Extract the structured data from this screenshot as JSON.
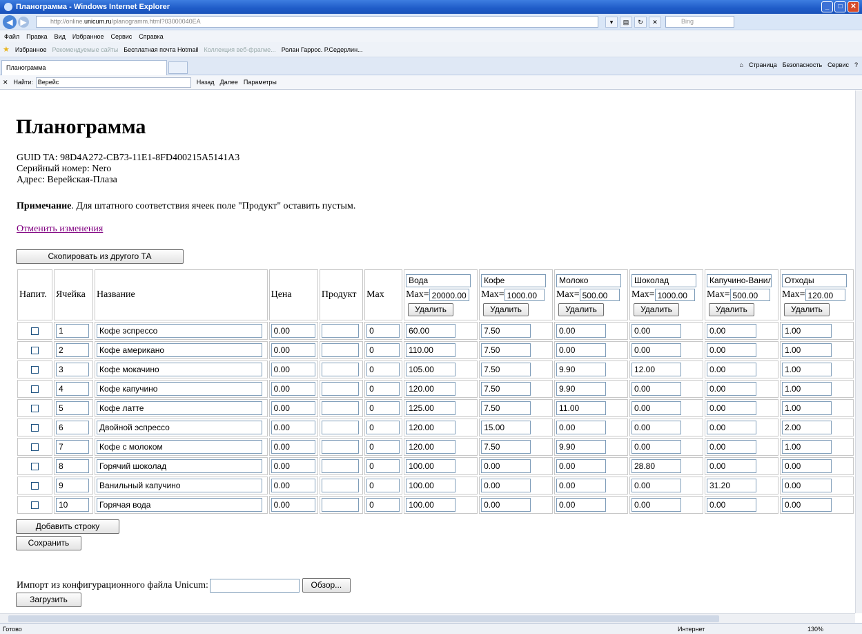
{
  "window": {
    "title": "Планограмма - Windows Internet Explorer"
  },
  "browser": {
    "url_prefix": "http://online.",
    "url_domain": "unicum.ru",
    "url_rest": "/planogramm.html?03000040EA",
    "search_placeholder": "Bing",
    "menu": [
      "Файл",
      "Правка",
      "Вид",
      "Избранное",
      "Сервис",
      "Справка"
    ],
    "favorites": [
      "Избранное",
      "Рекомендуемые сайты",
      "Бесплатная почта Hotmail",
      "Коллекция веб-фрагме...",
      "Ролан Гаррос. Р.Седерлин..."
    ],
    "tab_title": "Планограмма",
    "commands": [
      "Страница",
      "Безопасность",
      "Сервис"
    ],
    "find_label": "Найти:",
    "find_value": "Верейс",
    "find_prev": "Назад",
    "find_next": "Далее",
    "find_options": "Параметры",
    "status_left": "Готово",
    "status_zone": "Интернет",
    "status_zoom": "130%"
  },
  "page": {
    "title": "Планограмма",
    "guid_line": "GUID TA: 98D4A272-CB73-11E1-8FD400215A5141A3",
    "serial_line": "Серийный номер: Nero",
    "address_line": "Адрес: Верейская-Плаза",
    "note_bold": "Примечание",
    "note_text": ". Для штатного соответствия ячеек поле \"Продукт\" оставить пустым.",
    "cancel_link": "Отменить изменения",
    "copy_button": "Скопировать из другого ТА",
    "add_row_button": "Добавить строку",
    "save_button": "Сохранить",
    "import_label": "Импорт из конфигурационного файла Unicum:",
    "browse_button": "Обзор...",
    "load_button": "Загрузить"
  },
  "table": {
    "headers": {
      "drink": "Напит.",
      "cell": "Ячейка",
      "name": "Название",
      "price": "Цена",
      "product": "Продукт",
      "max": "Max"
    },
    "max_label": "Max=",
    "delete_label": "Удалить",
    "products": [
      {
        "name": "Вода",
        "max": "20000.00"
      },
      {
        "name": "Кофе",
        "max": "1000.00"
      },
      {
        "name": "Молоко",
        "max": "500.00"
      },
      {
        "name": "Шоколад",
        "max": "1000.00"
      },
      {
        "name": "Капучино-Ванильный",
        "max": "500.00"
      },
      {
        "name": "Отходы",
        "max": "120.00"
      }
    ],
    "rows": [
      {
        "cell": "1",
        "name": "Кофе эспрессо",
        "price": "0.00",
        "product": "",
        "max": "0",
        "p": [
          "60.00",
          "7.50",
          "0.00",
          "0.00",
          "0.00",
          "1.00"
        ]
      },
      {
        "cell": "2",
        "name": "Кофе американо",
        "price": "0.00",
        "product": "",
        "max": "0",
        "p": [
          "110.00",
          "7.50",
          "0.00",
          "0.00",
          "0.00",
          "1.00"
        ]
      },
      {
        "cell": "3",
        "name": "Кофе мокачино",
        "price": "0.00",
        "product": "",
        "max": "0",
        "p": [
          "105.00",
          "7.50",
          "9.90",
          "12.00",
          "0.00",
          "1.00"
        ]
      },
      {
        "cell": "4",
        "name": "Кофе капучино",
        "price": "0.00",
        "product": "",
        "max": "0",
        "p": [
          "120.00",
          "7.50",
          "9.90",
          "0.00",
          "0.00",
          "1.00"
        ]
      },
      {
        "cell": "5",
        "name": "Кофе латте",
        "price": "0.00",
        "product": "",
        "max": "0",
        "p": [
          "125.00",
          "7.50",
          "11.00",
          "0.00",
          "0.00",
          "1.00"
        ]
      },
      {
        "cell": "6",
        "name": "Двойной эспрессо",
        "price": "0.00",
        "product": "",
        "max": "0",
        "p": [
          "120.00",
          "15.00",
          "0.00",
          "0.00",
          "0.00",
          "2.00"
        ]
      },
      {
        "cell": "7",
        "name": "Кофе с молоком",
        "price": "0.00",
        "product": "",
        "max": "0",
        "p": [
          "120.00",
          "7.50",
          "9.90",
          "0.00",
          "0.00",
          "1.00"
        ]
      },
      {
        "cell": "8",
        "name": "Горячий шоколад",
        "price": "0.00",
        "product": "",
        "max": "0",
        "p": [
          "100.00",
          "0.00",
          "0.00",
          "28.80",
          "0.00",
          "0.00"
        ]
      },
      {
        "cell": "9",
        "name": "Ванильный капучино",
        "price": "0.00",
        "product": "",
        "max": "0",
        "p": [
          "100.00",
          "0.00",
          "0.00",
          "0.00",
          "31.20",
          "0.00"
        ]
      },
      {
        "cell": "10",
        "name": "Горячая вода",
        "price": "0.00",
        "product": "",
        "max": "0",
        "p": [
          "100.00",
          "0.00",
          "0.00",
          "0.00",
          "0.00",
          "0.00"
        ]
      }
    ]
  },
  "colors": {
    "titlebar": "#1f5cc8",
    "link_visited": "#800080"
  }
}
